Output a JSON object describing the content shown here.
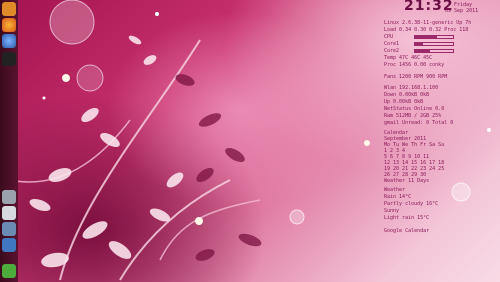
{
  "conky": {
    "clock": "21:32",
    "date_weekday": "Friday",
    "date_full": "09 Sep 2011",
    "lines": [
      "Linux 2.6.38-11-generic  Up 7h",
      "Load 0.34  0.30  0.32   Proc 118",
      "CPU        ",
      "Core1      ",
      "Core2      ",
      "Temp  47C   46C     45C",
      "Proc  1456  0.00   conky",
      "",
      "Fans 1200 RPM  900 RPM",
      "",
      "Wlan 192.168.1.100",
      "Down 0.00kB    0kB",
      "Up   0.00kB    0kB",
      "NetStatus  Online  0.0",
      "Ram  512MB / 2GB   25%",
      "gmail  Unread: 0   Total 0",
      "",
      "Calendar",
      "    September 2011",
      "Mo Tu We Th Fr Sa Su",
      "          1  2  3  4",
      " 5  6  7  8  9 10 11",
      "12 13 14 15 16 17 18",
      "19 20 21 22 23 24 25",
      "26 27 28 29 30",
      "Weather 11 Days",
      "",
      "Weather",
      "  Rain 14°C",
      "  Partly cloudy 16°C",
      "  Sunny",
      "  Light rain 15°C",
      "",
      "Google Calendar"
    ],
    "bars": [
      {
        "label": "CPU",
        "value": 0.58
      },
      {
        "label": "Core1",
        "value": 0.22
      },
      {
        "label": "Core2",
        "value": 0.4
      }
    ]
  },
  "dock": {
    "icons": [
      "home-folder-icon",
      "firefox-icon",
      "thunderbird-icon",
      "terminal-icon",
      "trash-icon",
      "user-icon",
      "settings-icon",
      "network-icon",
      "apps-icon"
    ]
  },
  "colors": {
    "conky_text": "#8a1a5a",
    "accent": "#a3134f"
  }
}
